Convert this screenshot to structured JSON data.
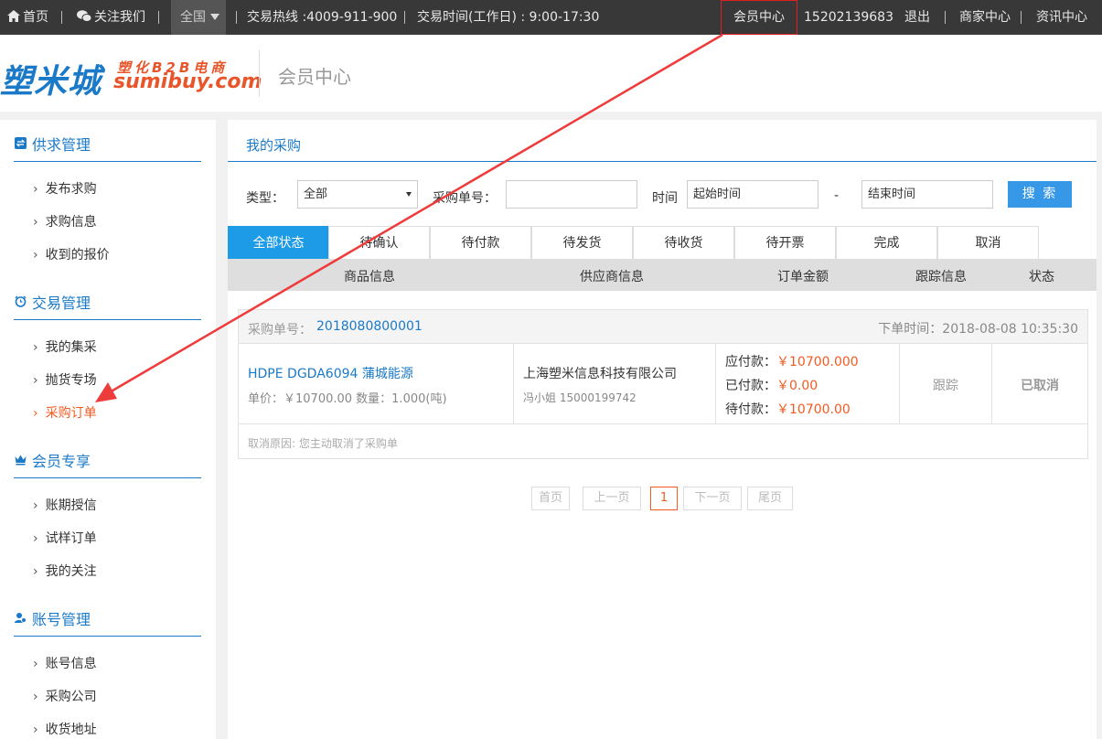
{
  "topbar": {
    "home": "首页",
    "follow": "关注我们",
    "region": "全国",
    "hotline": "交易热线 :4009-911-900",
    "hours": "交易时间(工作日) : 9:00-17:30",
    "member_center": "会员中心",
    "phone": "15202139683",
    "logout": "退出",
    "merchant_center": "商家中心",
    "news_center": "资讯中心"
  },
  "header": {
    "logo_cn": "塑米城",
    "logo_sub": "塑化B2B电商",
    "logo_en": "sumibuy.com",
    "title": "会员中心"
  },
  "sidebar": {
    "groups": [
      {
        "title": "供求管理",
        "icon": "exchange-icon",
        "items": [
          "发布求购",
          "求购信息",
          "收到的报价"
        ]
      },
      {
        "title": "交易管理",
        "icon": "alarm-icon",
        "items": [
          "我的集采",
          "抛货专场",
          "采购订单"
        ]
      },
      {
        "title": "会员专享",
        "icon": "crown-icon",
        "items": [
          "账期授信",
          "试样订单",
          "我的关注"
        ]
      },
      {
        "title": "账号管理",
        "icon": "users-icon",
        "items": [
          "账号信息",
          "采购公司",
          "收货地址"
        ]
      }
    ],
    "active_item": "采购订单",
    "accent": "#1a7ac8",
    "active_color": "#f25a22"
  },
  "main": {
    "title": "我的采购",
    "filters": {
      "type_label": "类型：",
      "type_value": "全部",
      "order_no_label": "采购单号：",
      "order_no_value": "",
      "time_label": "时间",
      "start_placeholder": "起始时间",
      "range_sep": "-",
      "end_placeholder": "结束时间",
      "search_button": "搜 索"
    },
    "tabs": [
      "全部状态",
      "待确认",
      "待付款",
      "待发货",
      "待收货",
      "待开票",
      "完成",
      "取消"
    ],
    "active_tab": "全部状态",
    "columns": [
      "商品信息",
      "供应商信息",
      "订单金额",
      "跟踪信息",
      "状态"
    ],
    "order": {
      "no_label": "采购单号：",
      "no": "2018080800001",
      "time": "下单时间：2018-08-08 10:35:30",
      "product_name": "HDPE DGDA6094 蒲城能源",
      "product_meta": "单价：￥10700.00 数量：1.000(吨)",
      "supplier": "上海塑米信息科技有限公司",
      "contact": "冯小姐 15000199742",
      "payable_label": "应付款：",
      "payable": "￥10700.000",
      "paid_label": "已付款：",
      "paid": "￥0.00",
      "due_label": "待付款：",
      "due": "￥10700.00",
      "track": "跟踪",
      "status": "已取消",
      "cancel_reason": "取消原因: 您主动取消了采购单"
    },
    "pager": [
      "首页",
      "上一页",
      "1",
      "下一页",
      "尾页"
    ],
    "current_page": "1"
  }
}
